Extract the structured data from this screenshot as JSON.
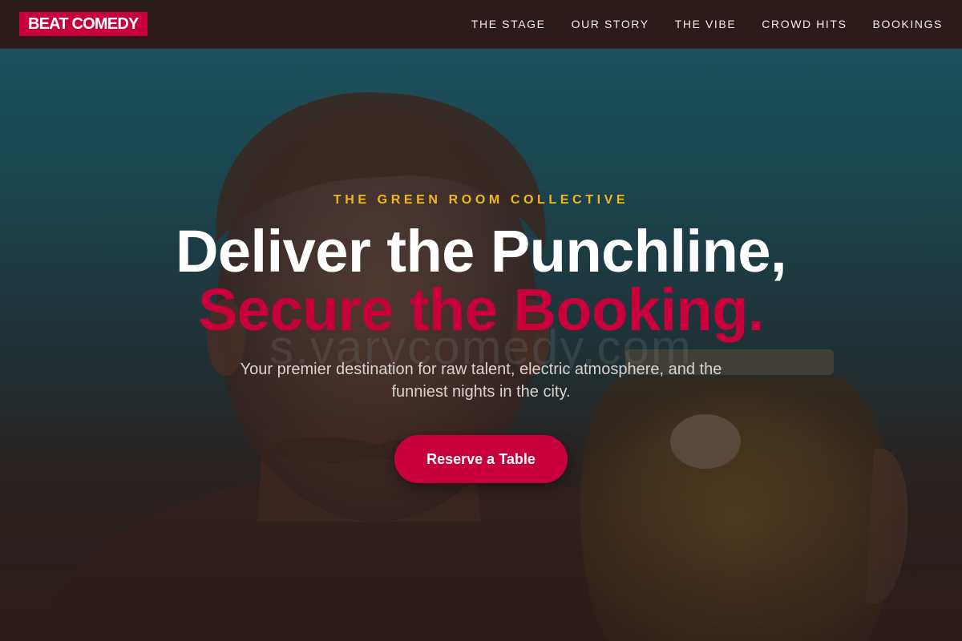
{
  "brand": {
    "logo_text": "BEAT COMEDY",
    "accent_color": "#c8003c",
    "eyebrow_color": "#f2b71e"
  },
  "nav": {
    "items": [
      {
        "label": "THE STAGE"
      },
      {
        "label": "OUR STORY"
      },
      {
        "label": "THE VIBE"
      },
      {
        "label": "CROWD HITS"
      },
      {
        "label": "BOOKINGS"
      }
    ]
  },
  "hero": {
    "eyebrow": "THE GREEN ROOM COLLECTIVE",
    "headline_line1": "Deliver the Punchline,",
    "headline_line2": "Secure the Booking.",
    "tagline": "Your premier destination for raw talent, electric atmosphere, and the funniest nights in the city.",
    "cta_label": "Reserve a Table",
    "watermark": "s.varycomedy.com"
  }
}
